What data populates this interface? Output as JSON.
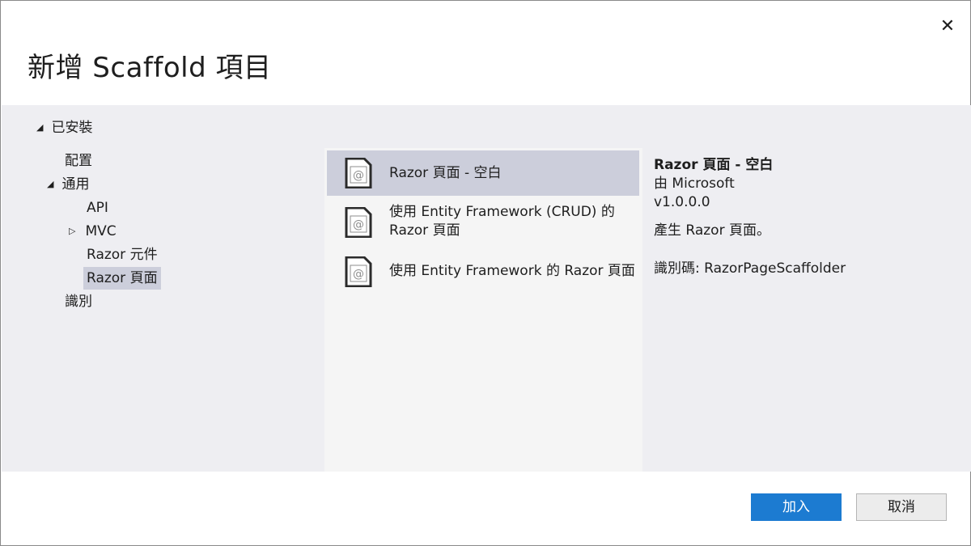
{
  "dialog": {
    "title": "新增 Scaffold 項目",
    "close_label": "✕"
  },
  "tree": {
    "root_label": "已安裝",
    "items": [
      {
        "label": "配置"
      },
      {
        "label": "通用"
      },
      {
        "label": "API"
      },
      {
        "label": "MVC"
      },
      {
        "label": "Razor 元件"
      },
      {
        "label": "Razor 頁面"
      },
      {
        "label": "識別"
      }
    ],
    "selected": "Razor 頁面"
  },
  "templates": [
    {
      "label": "Razor 頁面 - 空白",
      "icon": "razor-page-icon"
    },
    {
      "label_line1": "使用 Entity Framework (CRUD) 的",
      "label_line2": "Razor 頁面",
      "icon": "razor-page-icon"
    },
    {
      "label": "使用 Entity Framework 的 Razor 頁面",
      "icon": "razor-page-icon"
    }
  ],
  "details": {
    "title": "Razor 頁面 - 空白",
    "by": "由 Microsoft",
    "version": "v1.0.0.0",
    "description": "產生 Razor 頁面。",
    "id": "識別碼: RazorPageScaffolder"
  },
  "buttons": {
    "add": "加入",
    "cancel": "取消"
  },
  "colors": {
    "accent": "#1c7bd1",
    "selection": "#cccedb",
    "band": "#eeeef2"
  }
}
